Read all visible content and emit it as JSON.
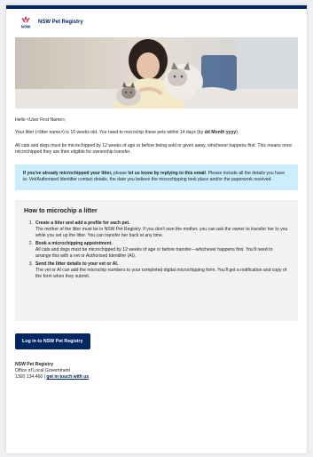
{
  "header": {
    "logo_text": "NSW",
    "title": "NSW Pet Registry"
  },
  "hero": {
    "alt": "person-with-cats-photo"
  },
  "greeting": "Hello <User First Name>,",
  "intro": {
    "before": "Your litter (<litter name>) is 10 weeks old. You need to microchip these pets within 14 days (by ",
    "date": "dd Month yyyy",
    "after": ")."
  },
  "rule_text": "All cats and dogs must be microchipped by 12 weeks of age or before being sold or given away, whichever happens first. This means once microchipped they are then eligible for ownership transfer.",
  "notice": {
    "bold_lead": "If you've already microchipped your litter,",
    "mid": " please ",
    "bold_action": "let us know by replying to this email",
    "rest": ". Please include all the details you have ie: Vet/Authorised Identifier contact details, the date you believe the microchipping took place and/or the paperwork received."
  },
  "howto": {
    "title": "How to microchip a litter",
    "steps": [
      {
        "num": "1.",
        "title": "Create a litter and add a profile for each pet.",
        "body": "The mother of the litter must be in NSW Pet Registry. If you don't own the mother, you can ask the owner to transfer her to you while you set up the litter. You can transfer her back at any time."
      },
      {
        "num": "2.",
        "title": "Book a microchipping appointment.",
        "body": "All cats and dogs must be microchipped by 12 weeks of age or before transfer—whichever happens first. You'll need to arrange this with a vet or Authorised Identifier (AI)."
      },
      {
        "num": "3.",
        "title": "Send the litter details to your vet or AI.",
        "body": "The vet or AI can add the microchip numbers to your completed digital microchipping form. You'll get a notification and copy of the form when they submit."
      }
    ]
  },
  "login_button": "Log in to NSW Pet Registry",
  "footer": {
    "org": "NSW Pet Registry",
    "dept": "Office of Local Government",
    "phone": "1300 134 460",
    "separator": " | ",
    "contact_link": "get in touch with us"
  },
  "colors": {
    "brand_navy": "#002664",
    "notice_bg": "#cbedfd",
    "howto_bg": "#f2f2f2",
    "logo_red": "#d7153a"
  }
}
